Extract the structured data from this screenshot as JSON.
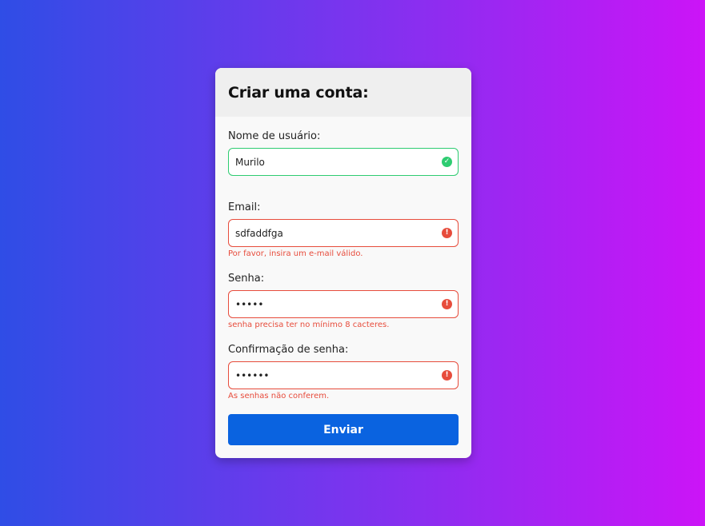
{
  "form": {
    "title": "Criar uma conta:",
    "fields": [
      {
        "label": "Nome de usuário:",
        "value": "Murilo",
        "status": "success",
        "error": ""
      },
      {
        "label": "Email:",
        "value": "sdfaddfga",
        "status": "error",
        "error": "Por favor, insira um e-mail válido."
      },
      {
        "label": "Senha:",
        "value": "•••••",
        "status": "error",
        "error": "senha precisa ter no mínimo 8 cacteres."
      },
      {
        "label": "Confirmação de senha:",
        "value": "••••••",
        "status": "error",
        "error": "As senhas não conferem."
      }
    ],
    "submit_label": "Enviar"
  },
  "colors": {
    "gradient_start": "#2f4de6",
    "gradient_end": "#cc14f7",
    "success": "#2ecc71",
    "error": "#e74c3c",
    "button": "#0a63e0"
  },
  "icons": {
    "success": "check-circle-icon",
    "error": "exclamation-circle-icon"
  }
}
